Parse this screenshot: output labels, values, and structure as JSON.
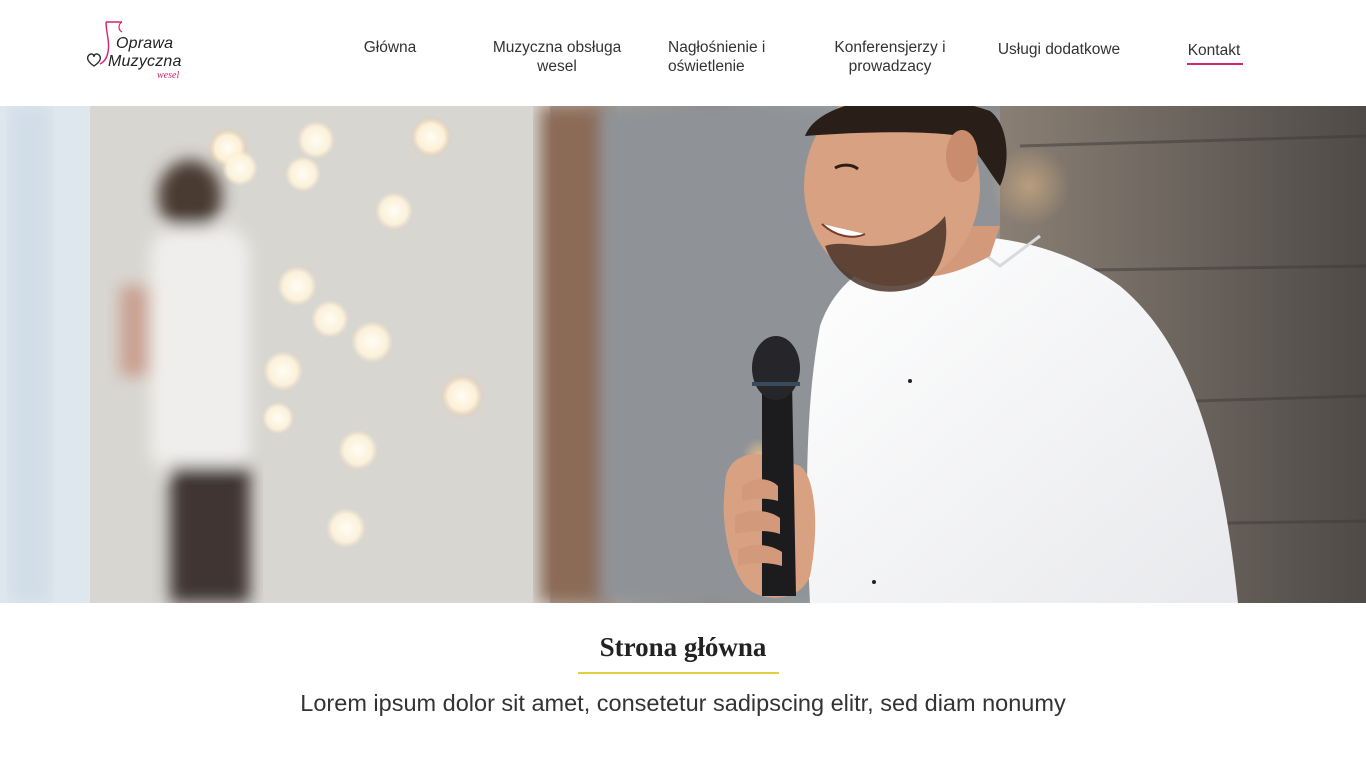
{
  "logo": {
    "line1": "Oprawa",
    "line2": "Muzyczna",
    "line3": "wesel",
    "accent_color": "#d6246e",
    "icons": [
      "music-note-icon",
      "heart-icon"
    ]
  },
  "nav": {
    "items": [
      {
        "label": "Główna"
      },
      {
        "label": "Muzyczna obsługa wesel"
      },
      {
        "label": "Nagłośnienie i oświetlenie"
      },
      {
        "label": "Konferensjerzy i prowadzacy"
      },
      {
        "label": "Usługi dodatkowe"
      },
      {
        "label": "Kontakt",
        "active": true
      }
    ],
    "active_color": "#d6246e"
  },
  "hero": {
    "image": "man-with-microphone-photo"
  },
  "main": {
    "title": "Strona główna",
    "title_underline_color": "#e6cf3e",
    "lead": "Lorem ipsum dolor sit amet, consetetur sadipscing elitr, sed diam nonumy"
  }
}
